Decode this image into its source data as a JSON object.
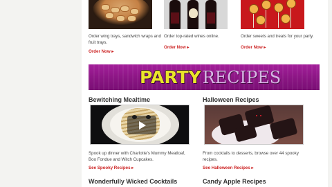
{
  "order_items": [
    {
      "desc": "Order wing trays, sandwich wraps and fruit trays.",
      "link": "Order Now ▸",
      "image": "wing-trays-image"
    },
    {
      "desc": "Order top-rated wines online.",
      "link": "Order Now ▸",
      "image": "wine-bottles-image"
    },
    {
      "desc": "Order sweets and treats for your party.",
      "link": "Order Now ▸",
      "image": "sweet-treats-image"
    }
  ],
  "banner": {
    "bold": "PARTY",
    "light": "RECIPES"
  },
  "recipes": [
    {
      "title": "Bewitching Mealtime",
      "desc": "Spook up dinner with Charlotte's Mummy Meatloaf, Boo Fondue and Witch Cupcakes.",
      "link": "See Spooky Recipes ▸",
      "next_title": "Wonderfully Wicked Cocktails"
    },
    {
      "title": "Halloween Recipes",
      "desc": "From cocktails to desserts, browse over 44 spooky recipes.",
      "link": "See Halloween Recipes ▸",
      "next_title": "Candy Apple Recipes"
    }
  ],
  "colors": {
    "link": "#cc2222",
    "banner": "#8a1583",
    "banner_bold": "#e9e52a"
  },
  "icons": {
    "video": "play-icon"
  }
}
